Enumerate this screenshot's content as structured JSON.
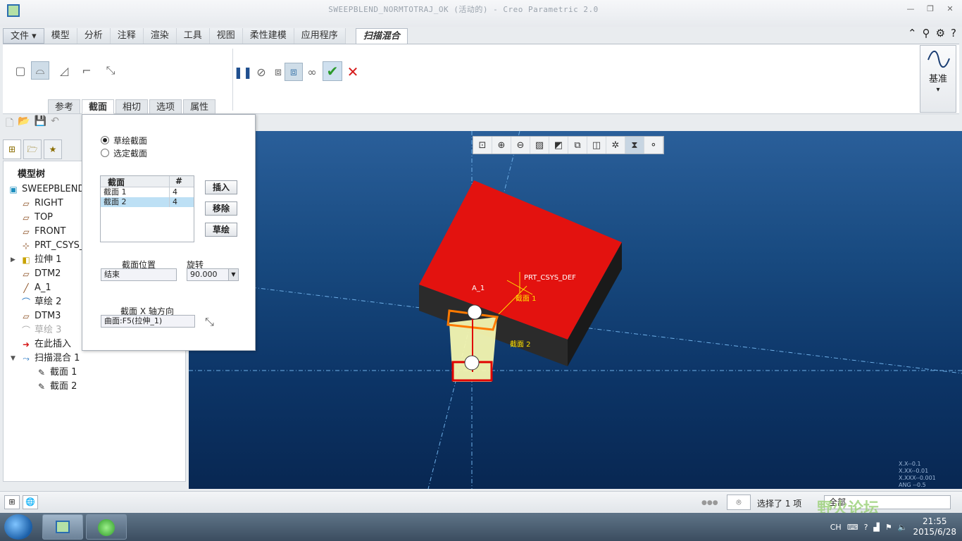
{
  "window": {
    "title": "SWEEPBLEND_NORMTOTRAJ_OK (活动的) - Creo Parametric 2.0",
    "controls": [
      "minimize",
      "restore",
      "close"
    ]
  },
  "ribbon": {
    "tabs": [
      "文件",
      "模型",
      "分析",
      "注释",
      "渲染",
      "工具",
      "视图",
      "柔性建模",
      "应用程序"
    ],
    "active_tab": "扫描混合",
    "sub_tabs": [
      "参考",
      "截面",
      "相切",
      "选项",
      "属性"
    ],
    "active_sub_tab": "截面",
    "datum_label": "基准",
    "datum_arrow": "▾"
  },
  "model_tree": {
    "header": "模型树",
    "items": [
      {
        "label": "SWEEPBLEND_N",
        "icon": "part-icon"
      },
      {
        "label": "RIGHT",
        "icon": "datum-plane-icon"
      },
      {
        "label": "TOP",
        "icon": "datum-plane-icon"
      },
      {
        "label": "FRONT",
        "icon": "datum-plane-icon"
      },
      {
        "label": "PRT_CSYS_D",
        "icon": "csys-icon"
      },
      {
        "label": "拉伸 1",
        "icon": "extrude-icon"
      },
      {
        "label": "DTM2",
        "icon": "datum-plane-icon"
      },
      {
        "label": "A_1",
        "icon": "axis-icon"
      },
      {
        "label": "草绘 2",
        "icon": "sketch-icon"
      },
      {
        "label": "DTM3",
        "icon": "datum-plane-icon"
      },
      {
        "label": "草绘 3",
        "icon": "sketch-icon"
      },
      {
        "label": "在此插入",
        "icon": "insert-arrow-icon"
      },
      {
        "label": "扫描混合 1",
        "icon": "sweep-blend-icon"
      },
      {
        "label": "截面 1",
        "icon": "section-icon"
      },
      {
        "label": "截面 2",
        "icon": "section-icon"
      }
    ]
  },
  "section_panel": {
    "radio_sketch": "草绘截面",
    "radio_selected": "选定截面",
    "table_headers": [
      "截面",
      "#"
    ],
    "rows": [
      {
        "name": "截面 1",
        "count": "4"
      },
      {
        "name": "截面 2",
        "count": "4"
      }
    ],
    "btn_insert": "插入",
    "btn_remove": "移除",
    "btn_sketch": "草绘",
    "position_label": "截面位置",
    "position_value": "结束",
    "rotation_label": "旋转",
    "rotation_value": "90.000",
    "x_axis_label": "截面 X 轴方向",
    "x_axis_value": "曲面:F5(拉伸_1)"
  },
  "viewport": {
    "labels": {
      "csys": "PRT_CSYS_DEF",
      "section1": "截面 1",
      "section2": "截面 2",
      "axis": "A_1"
    },
    "readout": [
      "X.X--0.1",
      "X.XX--0.01",
      "X.XXX--0.001",
      "ANG --0.5"
    ],
    "colors": {
      "body": "#e3120f",
      "sweep": "#f4f6b0",
      "outline_orange": "#ff7a00",
      "outline_red": "#e00000"
    }
  },
  "status": {
    "selection": "选择了 1 项",
    "filter": "全部"
  },
  "taskbar": {
    "lang": "CH",
    "time": "21:55",
    "date": "2015/6/28"
  },
  "watermark": "野火论坛"
}
